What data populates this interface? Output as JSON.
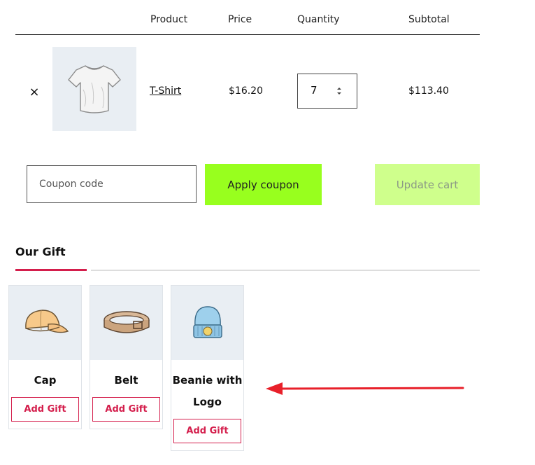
{
  "cart": {
    "headers": {
      "product": "Product",
      "price": "Price",
      "quantity": "Quantity",
      "subtotal": "Subtotal"
    },
    "item": {
      "remove_symbol": "×",
      "name": "T-Shirt",
      "price": "$16.20",
      "quantity": "7",
      "subtotal": "$113.40",
      "image_icon": "tshirt-icon"
    }
  },
  "coupon": {
    "placeholder": "Coupon code",
    "apply_label": "Apply coupon",
    "update_label": "Update cart"
  },
  "gifts": {
    "title": "Our Gift",
    "items": [
      {
        "name": "Cap",
        "button": "Add Gift",
        "icon": "cap-icon"
      },
      {
        "name": "Belt",
        "button": "Add Gift",
        "icon": "belt-icon"
      },
      {
        "name": "Beanie with Logo",
        "button": "Add Gift",
        "icon": "beanie-icon"
      }
    ]
  },
  "colors": {
    "accent": "#d41e4c",
    "apply_button": "#98ff1e",
    "update_button": "#cfff8c",
    "image_bg": "#e9eef3",
    "arrow": "#e8202a"
  }
}
